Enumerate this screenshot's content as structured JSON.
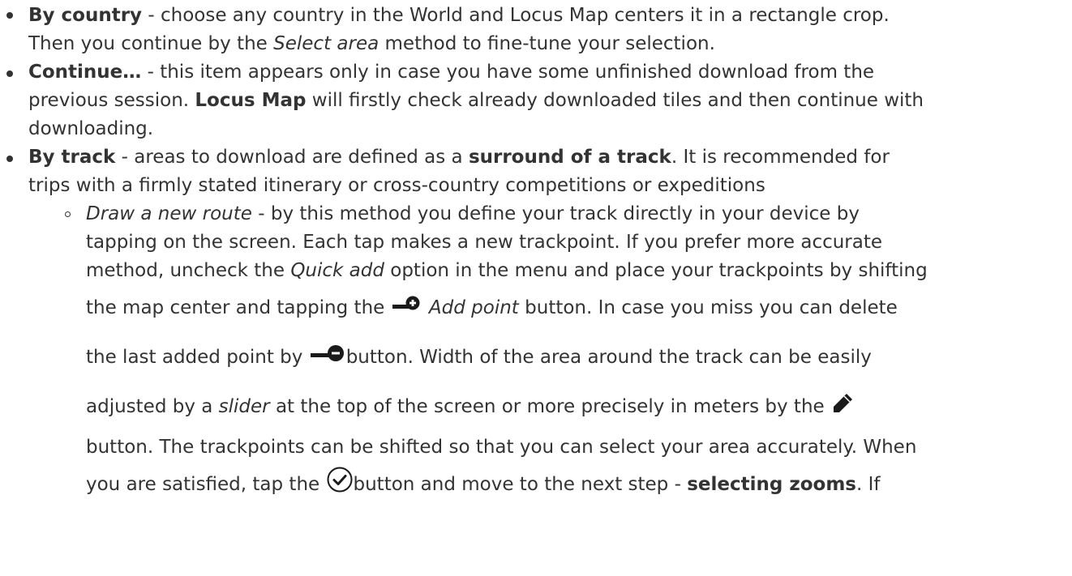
{
  "items": [
    {
      "title": "By country",
      "text_a": " - choose any country in the World and Locus Map centers it in a rectangle crop.",
      "text_b": "Then you continue by the ",
      "select_area": "Select area",
      "text_c": " method to fine-tune your selection."
    },
    {
      "title": "Continue…",
      "text_a": " - this item appears only in case you have some unfinished download from the",
      "text_b": "previous session. ",
      "locus_map": "Locus Map",
      "text_c": " will firstly check already downloaded tiles and then continue with",
      "text_d": "downloading."
    },
    {
      "title": "By track",
      "text_a": " - areas to download are defined as a ",
      "surround": "surround of a track",
      "text_b": ". It is recommended for",
      "text_c": "trips with a firmly stated itinerary or cross-country competitions or expeditions",
      "sub": {
        "draw_new_route": "Draw a new route",
        "s1": " - by this method you define your track directly in your device by",
        "s2": "tapping on the screen. Each tap makes a new trackpoint. If you prefer more accurate",
        "s3a": "method, uncheck the ",
        "quick_add": "Quick add",
        "s3b": " option in the menu and place your trackpoints by shifting",
        "s4a": "the map center and tapping the ",
        "add_point": "Add point",
        "s4b": " button. In case you miss you can delete",
        "s5a": "the last added point by ",
        "s5b": "button. Width of the area around the track can be easily",
        "s6a": "adjusted by a ",
        "slider": "slider",
        "s6b": " at the top of the screen or more precisely in meters by the",
        "s7": "button. The trackpoints can be shifted so that you can select your area accurately. When",
        "s8a": "you are satisfied, tap the ",
        "s8b": "button and move to the next step - ",
        "selecting_zooms": "selecting zooms",
        "s8c": ". If"
      }
    }
  ],
  "icons": {
    "add_point": "add-point-icon",
    "remove_point": "remove-point-icon",
    "edit": "pencil-icon",
    "confirm": "check-circle-icon"
  },
  "colors": {
    "text": "#333333",
    "icon": "#1a1a1a",
    "background": "#ffffff"
  }
}
